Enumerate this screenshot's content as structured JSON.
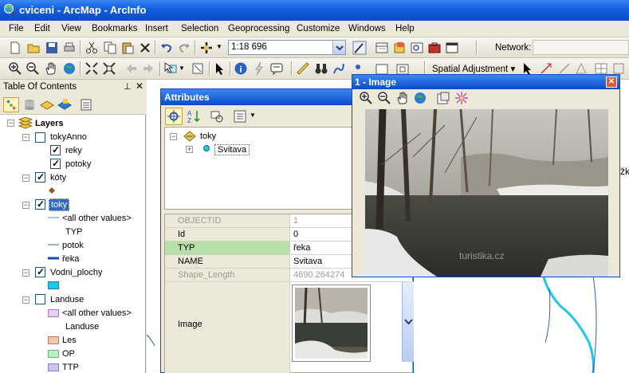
{
  "window": {
    "title": "cviceni - ArcMap - ArcInfo"
  },
  "menu": [
    "File",
    "Edit",
    "View",
    "Bookmarks",
    "Insert",
    "Selection",
    "Geoprocessing",
    "Customize",
    "Windows",
    "Help"
  ],
  "toolbar": {
    "scale_value": "1:18 696",
    "network_label": "Network:",
    "spatial_adjustment_label": "Spatial Adjustment ▾"
  },
  "toc": {
    "title": "Table Of Contents",
    "pin": "⊥",
    "close": "✕",
    "group": "Layers",
    "items": {
      "tokyAnno": "tokyAnno",
      "reky": "reky",
      "potoky": "potoky",
      "koty": "kóty",
      "toky": "toky",
      "all_other_1": "<all other values>",
      "typ": "TYP",
      "potok": "potok",
      "reka": "řeka",
      "vodni": "Vodni_plochy",
      "landuse": "Landuse",
      "all_other_2": "<all other values>",
      "landuse_sub": "Landuse",
      "les": "Les",
      "op": "OP",
      "ttp": "TTP"
    }
  },
  "attributes": {
    "title": "Attributes",
    "tree_layer": "toky",
    "tree_feature": "Svitava",
    "fields": [
      {
        "name": "OBJECTID",
        "value": "1"
      },
      {
        "name": "Id",
        "value": "0"
      },
      {
        "name": "TYP",
        "value": "řeka"
      },
      {
        "name": "NAME",
        "value": "Svitava"
      },
      {
        "name": "Shape_Length",
        "value": "4690.264274"
      }
    ],
    "image_field": "Image"
  },
  "image_window": {
    "title": "1 - Image",
    "close": "✕",
    "watermark": "turistika.cz"
  },
  "map": {
    "edge_label": "žk"
  },
  "colors": {
    "xp_blue": "#0a4bc8",
    "river": "#1ec8e8",
    "water_fill": "#1ec8e8",
    "les": "#f4c7a8",
    "op": "#b8f0c0",
    "ttp": "#c8c4f4",
    "all_other": "#e0c8f0",
    "selected_field": "#b7e0a8"
  }
}
